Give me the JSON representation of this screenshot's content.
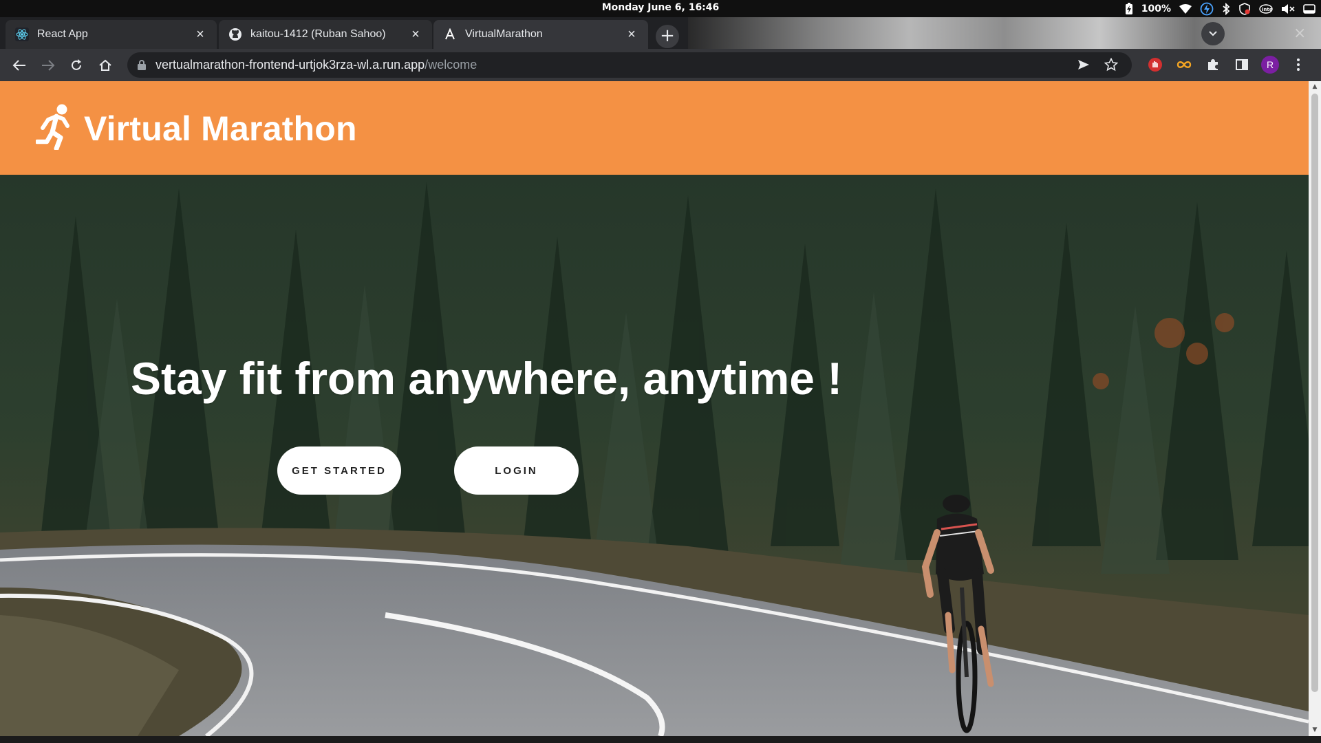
{
  "os": {
    "clock": "Monday June  6, 16:46",
    "battery": "100%"
  },
  "browser": {
    "tabs": [
      {
        "label": "React App",
        "icon": "react-icon",
        "active": false
      },
      {
        "label": "kaitou-1412 (Ruban Sahoo)",
        "icon": "github-icon",
        "active": false
      },
      {
        "label": "VirtualMarathon",
        "icon": "app-favicon",
        "active": true
      }
    ],
    "url_host": "vertualmarathon-frontend-urtjok3rza-wl.a.run.app",
    "url_path": "/welcome",
    "profile_initial": "R"
  },
  "header": {
    "title": "Virtual Marathon",
    "logo_icon": "runner-icon",
    "background": "#f49144"
  },
  "hero": {
    "heading": "Stay fit from anywhere, anytime !",
    "get_started_label": "GET STARTED",
    "login_label": "LOGIN"
  }
}
